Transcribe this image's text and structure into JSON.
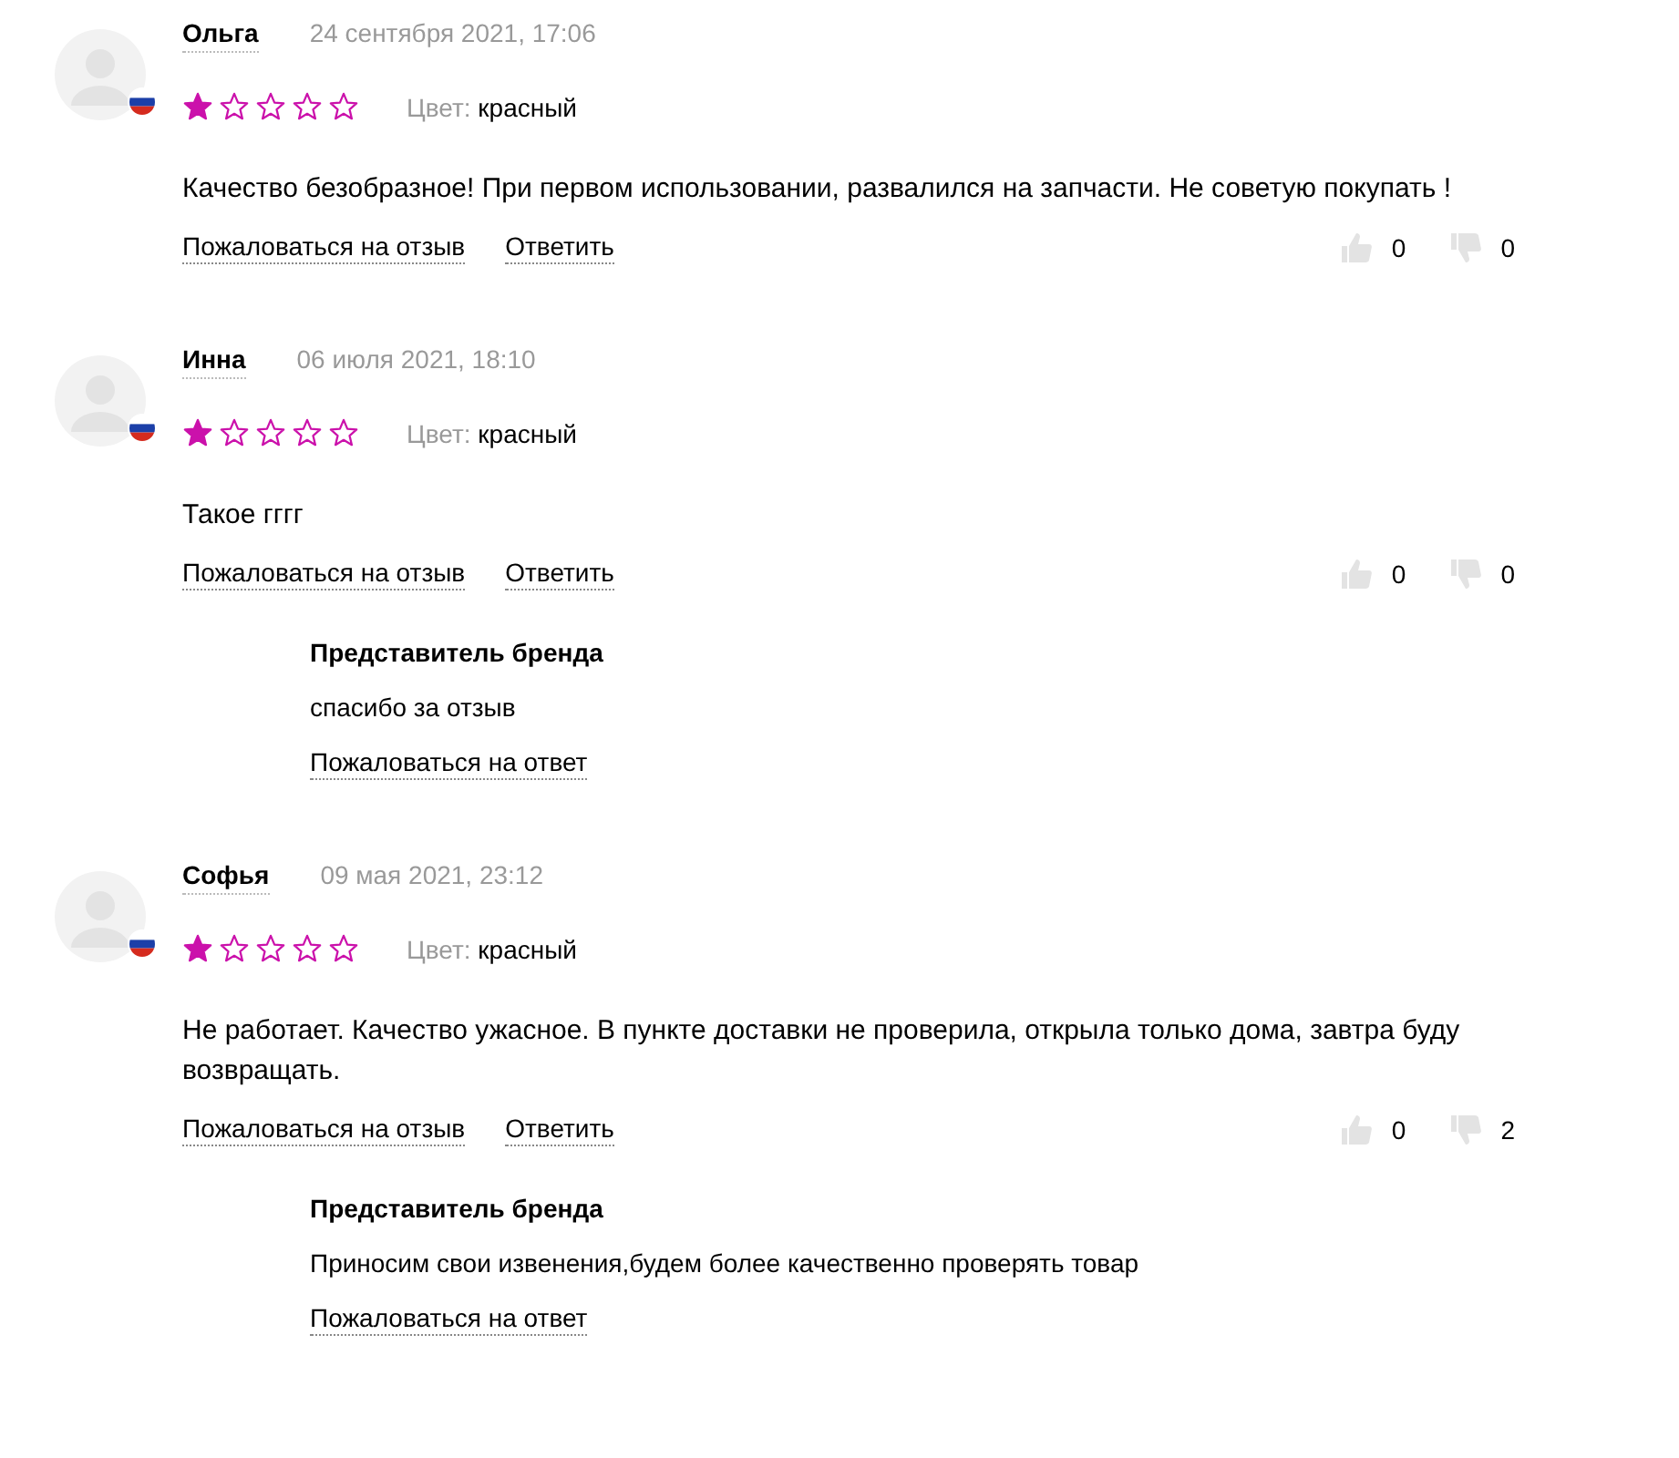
{
  "reviews": [
    {
      "author": "Ольга",
      "date": "24 сентября 2021, 17:06",
      "stars": 1,
      "color_label": "Цвет:",
      "color_value": "красный",
      "text": "Качество безобразное! При первом использовании, развалился на запчасти. Не советую покупать !",
      "complain": "Пожаловаться на отзыв",
      "reply": "Ответить",
      "likes": "0",
      "dislikes": "0"
    },
    {
      "author": "Инна",
      "date": "06 июля 2021, 18:10",
      "stars": 1,
      "color_label": "Цвет:",
      "color_value": "красный",
      "text": "Такое гггг",
      "complain": "Пожаловаться на отзыв",
      "reply": "Ответить",
      "likes": "0",
      "dislikes": "0",
      "answer": {
        "author": "Представитель бренда",
        "text": "спасибо за отзыв",
        "complain": "Пожаловаться на ответ"
      }
    },
    {
      "author": "Софья",
      "date": "09 мая 2021, 23:12",
      "stars": 1,
      "color_label": "Цвет:",
      "color_value": "красный",
      "text": "Не работает. Качество ужасное. В пункте доставки не проверила, открыла только дома, завтра буду возвращать.",
      "complain": "Пожаловаться на отзыв",
      "reply": "Ответить",
      "likes": "0",
      "dislikes": "2",
      "answer": {
        "author": "Представитель бренда",
        "text": "Приносим свои извенения,будем более качественно проверять товар",
        "complain": "Пожаловаться на ответ"
      }
    }
  ]
}
